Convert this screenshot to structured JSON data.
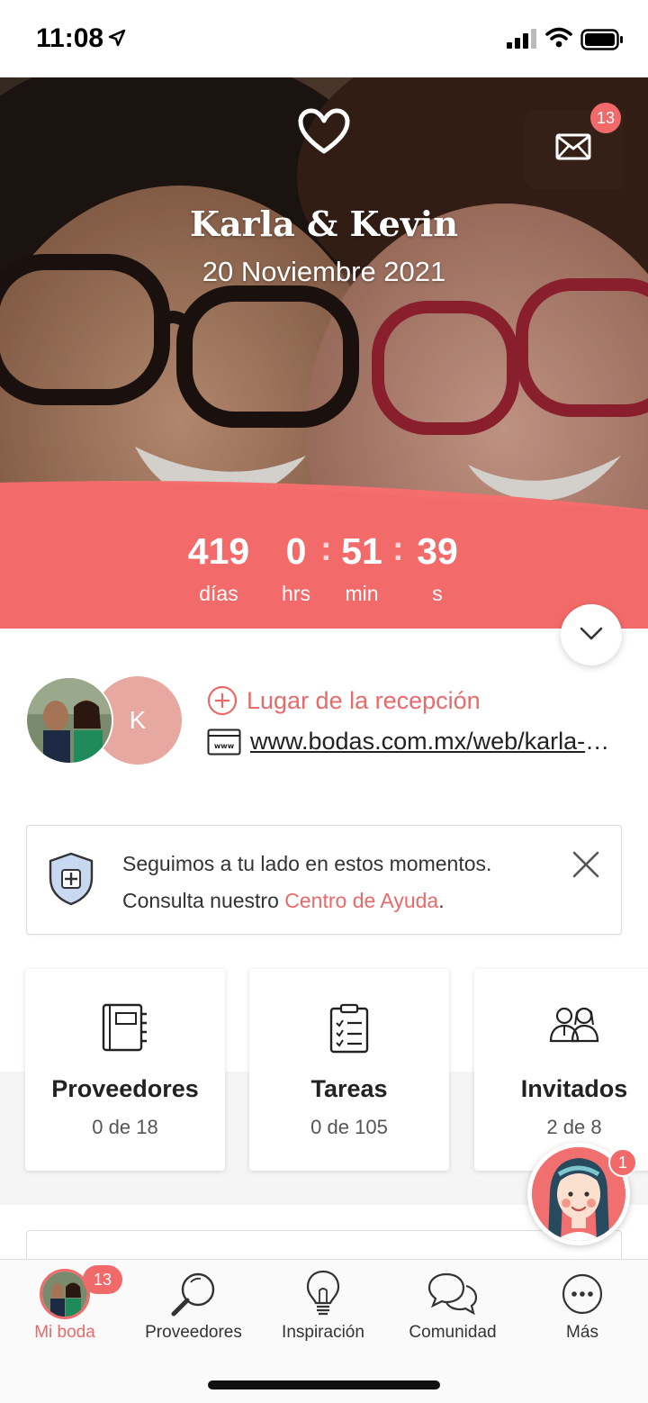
{
  "status_bar": {
    "time": "11:08"
  },
  "header": {
    "mail_badge": "13",
    "couple_names": "Karla & Kevin",
    "wedding_date": "20 Noviembre 2021"
  },
  "countdown": {
    "days": "419",
    "days_label": "días",
    "hours": "0",
    "hours_label": "hrs",
    "minutes": "51",
    "minutes_label": "min",
    "seconds": "39",
    "seconds_label": "s"
  },
  "couple_info": {
    "avatar_initial": "K",
    "reception_label": "Lugar de la recepción",
    "website": "www.bodas.com.mx/web/karla-y-kevin"
  },
  "notice": {
    "line1": "Seguimos a tu lado en estos momentos.",
    "line2_prefix": "Consulta nuestro ",
    "link": "Centro de Ayuda",
    "line2_suffix": "."
  },
  "cards": [
    {
      "title": "Proveedores",
      "subtitle": "0 de 18",
      "icon": "notebook-icon"
    },
    {
      "title": "Tareas",
      "subtitle": "0 de 105",
      "icon": "checklist-icon"
    },
    {
      "title": "Invitados",
      "subtitle": "2 de 8",
      "icon": "guests-icon"
    }
  ],
  "assistant": {
    "badge": "1"
  },
  "tabbar": {
    "items": [
      {
        "label": "Mi boda",
        "badge": "13",
        "icon": "avatar"
      },
      {
        "label": "Proveedores",
        "icon": "magnifier-icon"
      },
      {
        "label": "Inspiración",
        "icon": "lightbulb-icon"
      },
      {
        "label": "Comunidad",
        "icon": "chat-bubbles-icon"
      },
      {
        "label": "Más",
        "icon": "more-icon"
      }
    ]
  },
  "colors": {
    "accent": "#f06a6a",
    "link": "#e86a6a"
  }
}
